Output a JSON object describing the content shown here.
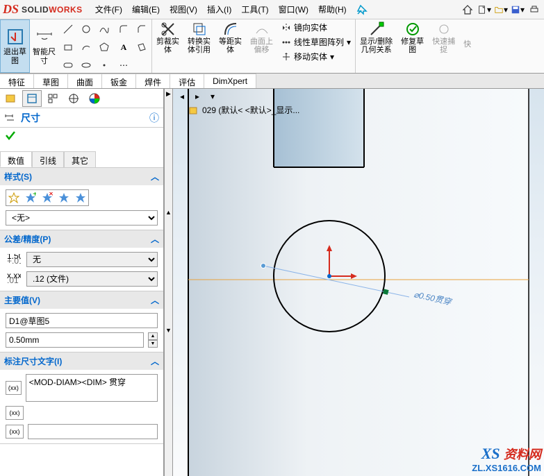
{
  "logo": {
    "ds": "DS",
    "brand_solid": "SOLID",
    "brand_works": "WORKS"
  },
  "menu": {
    "file": "文件(F)",
    "edit": "编辑(E)",
    "view": "视图(V)",
    "insert": "插入(I)",
    "tools": "工具(T)",
    "window": "窗口(W)",
    "help": "帮助(H)"
  },
  "ribbon": {
    "exit_sketch": "退出草\n图",
    "smart_dim": "智能尺\n寸",
    "trim": "剪裁实\n体",
    "convert": "转换实\n体引用",
    "offset": "等距实\n体",
    "curve_offset": "曲面上\n偏移",
    "mirror": "镜向实体",
    "linear_pattern": "线性草图阵列",
    "move": "移动实体",
    "show_hide": "显示/删除\n几何关系",
    "repair": "修复草\n图",
    "quick_snap": "快速捕\n捉",
    "quick_short": "快"
  },
  "cmd_tabs": {
    "feature": "特征",
    "sketch": "草图",
    "surface": "曲面",
    "sheetmetal": "钣金",
    "weldment": "焊件",
    "evaluate": "评估",
    "dimxpert": "DimXpert"
  },
  "doc_title": "029  (默认< <默认>_显示...",
  "panel": {
    "title": "尺寸",
    "tab_value": "数值",
    "tab_leader": "引线",
    "tab_other": "其它",
    "sec_style": "样式(S)",
    "style_none": "<无>",
    "sec_tolerance": "公差/精度(P)",
    "tol_none": "无",
    "prec_12": ".12 (文件)",
    "sec_primary": "主要值(V)",
    "d1_value": "D1@草图5",
    "val_050": "0.50mm",
    "sec_annotext": "标注尺寸文字(I)",
    "anno_text": "<MOD-DIAM><DIM> 贯穿"
  },
  "graphics": {
    "dim_label": "⌀0.50贯穿"
  },
  "watermark": {
    "xs": "XS",
    "name": "资料网",
    "url": "ZL.XS1616.COM"
  },
  "colors": {
    "accent_blue": "#0066cc",
    "red": "#d52b1e",
    "construction": "#e8a23d",
    "sketch_black": "#000000",
    "dim_blue": "#8bb4e8"
  }
}
